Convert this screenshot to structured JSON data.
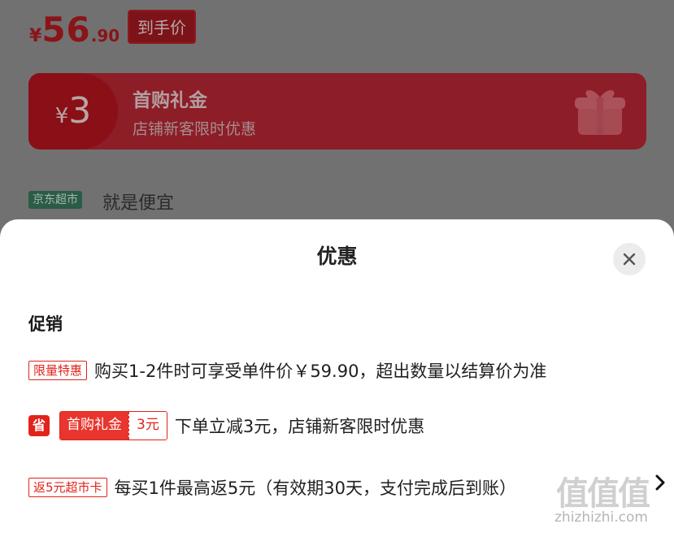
{
  "background": {
    "price_symbol": "¥",
    "price_integer": "56",
    "price_decimal": ".90",
    "price_tag": "到手价",
    "coupon_banner": {
      "amount_symbol": "¥",
      "amount": "3",
      "title": "首购礼金",
      "subtitle": "店铺新客限时优惠"
    },
    "market_badge": "京东超市",
    "market_slogan": "就是便宜"
  },
  "sheet": {
    "title": "优惠",
    "section_title": "促销",
    "promotions": [
      {
        "tag": "限量特惠",
        "description": "购买1-2件时可享受单件价￥59.90，超出数量以结算价为准"
      },
      {
        "icon_label": "省",
        "coupon_label": "首购礼金",
        "coupon_value": "3元",
        "description": "下单立减3元，店铺新客限时优惠"
      },
      {
        "tag": "返5元超市卡",
        "description": "每买1件最高返5元（有效期30天，支付完成后到账）"
      }
    ]
  },
  "watermark": {
    "logo": "值值值",
    "text": "zhizhizhi.com"
  },
  "colors": {
    "accent": "#e2231a",
    "market_green": "#2a5c46",
    "overlay": "#717171"
  },
  "icons": [
    "close-icon",
    "chevron-right-icon",
    "gift-icon"
  ]
}
